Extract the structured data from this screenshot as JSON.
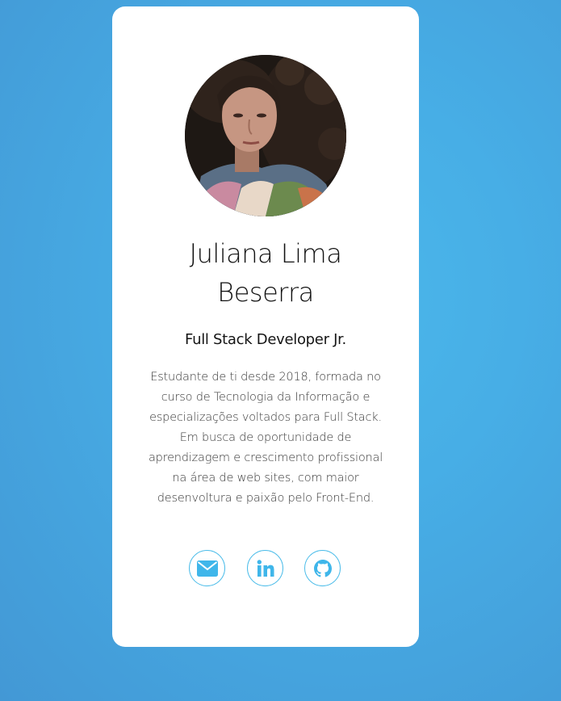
{
  "profile": {
    "name": "Juliana Lima Beserra",
    "role": "Full Stack Developer Jr.",
    "bio": "Estudante de ti desde 2018, formada no curso de Tecnologia da Informação e especializações voltados para Full Stack. Em busca de oportunidade de aprendizagem e crescimento profissional na área de web sites, com maior desenvoltura e paixão pelo Front-End.",
    "photo": "profile-photo"
  },
  "social": [
    {
      "icon": "envelope-icon"
    },
    {
      "icon": "linkedin-icon"
    },
    {
      "icon": "github-icon"
    }
  ],
  "colors": {
    "background": "#47aee6",
    "card": "#ffffff",
    "accent": "#3fb6ea"
  }
}
